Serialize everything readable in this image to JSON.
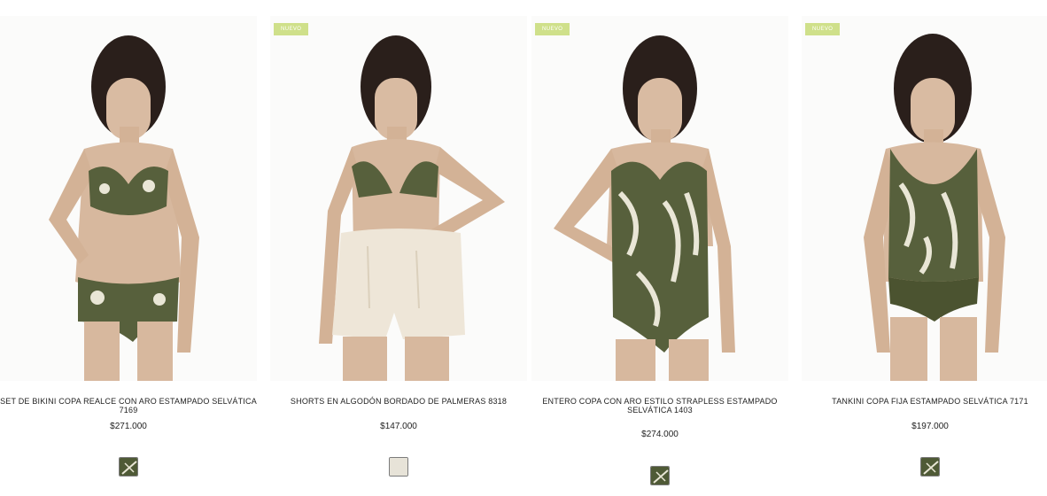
{
  "products": [
    {
      "name": "SET DE BIKINI COPA REALCE CON ARO ESTAMPADO SELVÁTICA 7169",
      "price": "$271.000",
      "badge": "",
      "swatch_color": "#4f5a36"
    },
    {
      "name": "SHORTS EN ALGODÓN BORDADO DE PALMERAS 8318",
      "price": "$147.000",
      "badge": "NUEVO",
      "swatch_color": "#e7e3d8"
    },
    {
      "name": "ENTERO COPA CON ARO ESTILO STRAPLESS ESTAMPADO SELVÁTICA 1403",
      "price": "$274.000",
      "badge": "NUEVO",
      "swatch_color": "#4f5a36"
    },
    {
      "name": "TANKINI COPA FIJA ESTAMPADO SELVÁTICA 7171",
      "price": "$197.000",
      "badge": "NUEVO",
      "swatch_color": "#4f5a36"
    }
  ],
  "colors": {
    "badge": "#cfe08a",
    "print_green": "#57603c",
    "print_cream": "#e9e6d6",
    "skin": "#d7b89e",
    "hair": "#2a1f1b"
  }
}
